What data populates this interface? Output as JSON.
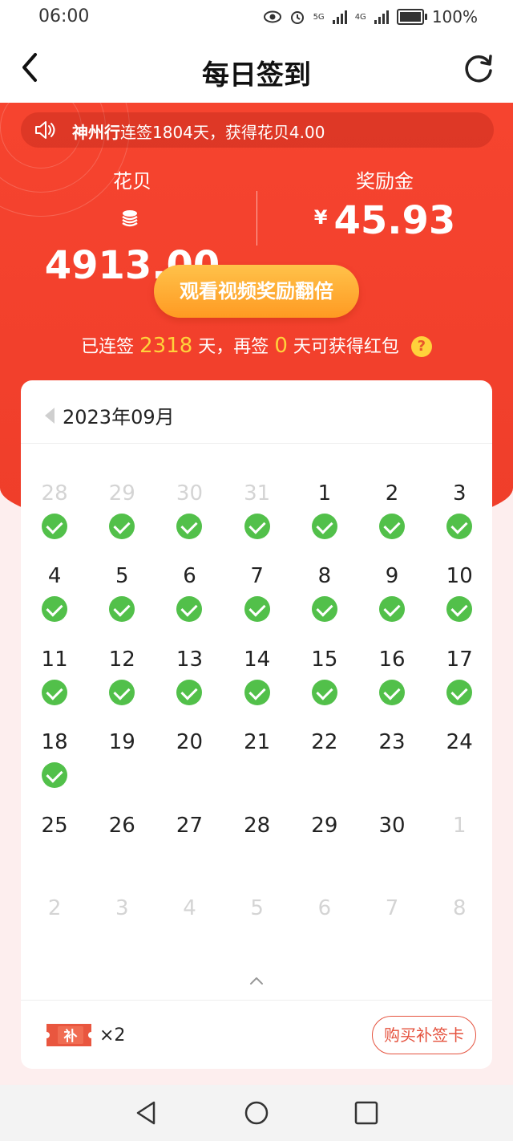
{
  "status": {
    "time": "06:00",
    "net1": "5G",
    "net2": "4G",
    "battery": "100%"
  },
  "header": {
    "title": "每日签到"
  },
  "notice": {
    "user": "神州行",
    "text": "连签1804天，获得花贝4.00"
  },
  "stats": {
    "huabei": {
      "label": "花贝",
      "value": "4913.00"
    },
    "reward": {
      "label": "奖励金",
      "currency": "¥",
      "value": "45.93"
    }
  },
  "cta": {
    "label": "观看视频奖励翻倍"
  },
  "streak": {
    "prefix": "已连签",
    "days": "2318",
    "mid": "天，再签",
    "remain": "0",
    "suffix": "天可获得红包",
    "help": "?"
  },
  "calendar": {
    "month": "2023年09月",
    "days": [
      {
        "n": "28",
        "faded": true,
        "checked": true
      },
      {
        "n": "29",
        "faded": true,
        "checked": true
      },
      {
        "n": "30",
        "faded": true,
        "checked": true
      },
      {
        "n": "31",
        "faded": true,
        "checked": true
      },
      {
        "n": "1",
        "faded": false,
        "checked": true
      },
      {
        "n": "2",
        "faded": false,
        "checked": true
      },
      {
        "n": "3",
        "faded": false,
        "checked": true
      },
      {
        "n": "4",
        "faded": false,
        "checked": true
      },
      {
        "n": "5",
        "faded": false,
        "checked": true
      },
      {
        "n": "6",
        "faded": false,
        "checked": true
      },
      {
        "n": "7",
        "faded": false,
        "checked": true
      },
      {
        "n": "8",
        "faded": false,
        "checked": true
      },
      {
        "n": "9",
        "faded": false,
        "checked": true
      },
      {
        "n": "10",
        "faded": false,
        "checked": true
      },
      {
        "n": "11",
        "faded": false,
        "checked": true
      },
      {
        "n": "12",
        "faded": false,
        "checked": true
      },
      {
        "n": "13",
        "faded": false,
        "checked": true
      },
      {
        "n": "14",
        "faded": false,
        "checked": true
      },
      {
        "n": "15",
        "faded": false,
        "checked": true
      },
      {
        "n": "16",
        "faded": false,
        "checked": true
      },
      {
        "n": "17",
        "faded": false,
        "checked": true
      },
      {
        "n": "18",
        "faded": false,
        "checked": true
      },
      {
        "n": "19",
        "faded": false,
        "checked": false
      },
      {
        "n": "20",
        "faded": false,
        "checked": false
      },
      {
        "n": "21",
        "faded": false,
        "checked": false
      },
      {
        "n": "22",
        "faded": false,
        "checked": false
      },
      {
        "n": "23",
        "faded": false,
        "checked": false
      },
      {
        "n": "24",
        "faded": false,
        "checked": false
      },
      {
        "n": "25",
        "faded": false,
        "checked": false
      },
      {
        "n": "26",
        "faded": false,
        "checked": false
      },
      {
        "n": "27",
        "faded": false,
        "checked": false
      },
      {
        "n": "28",
        "faded": false,
        "checked": false
      },
      {
        "n": "29",
        "faded": false,
        "checked": false
      },
      {
        "n": "30",
        "faded": false,
        "checked": false
      },
      {
        "n": "1",
        "faded": true,
        "checked": false
      },
      {
        "n": "2",
        "faded": true,
        "checked": false
      },
      {
        "n": "3",
        "faded": true,
        "checked": false
      },
      {
        "n": "4",
        "faded": true,
        "checked": false
      },
      {
        "n": "5",
        "faded": true,
        "checked": false
      },
      {
        "n": "6",
        "faded": true,
        "checked": false
      },
      {
        "n": "7",
        "faded": true,
        "checked": false
      },
      {
        "n": "8",
        "faded": true,
        "checked": false
      }
    ]
  },
  "footer": {
    "ticket_glyph": "补",
    "count": "×2",
    "buy_label": "购买补签卡"
  },
  "colors": {
    "accent": "#f2402c",
    "check": "#52c04a",
    "cta": "#ffa52e",
    "highlight": "#ffd23b"
  },
  "icons": [
    "back-arrow-icon",
    "refresh-icon",
    "speaker-icon",
    "coin-stack-icon",
    "calendar-prev-icon",
    "collapse-caret-icon",
    "makeup-card-icon",
    "nav-back-icon",
    "nav-home-icon",
    "nav-recent-icon"
  ]
}
